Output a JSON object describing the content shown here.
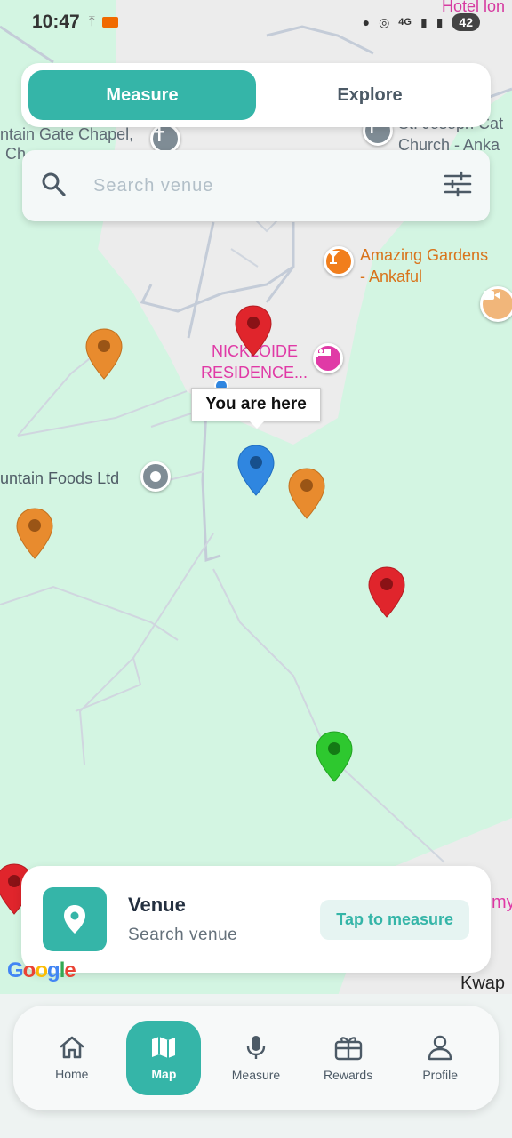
{
  "status_bar": {
    "time": "10:47",
    "network": "4G",
    "battery": "42"
  },
  "toggle": {
    "measure_label": "Measure",
    "explore_label": "Explore",
    "active": "Measure"
  },
  "search": {
    "placeholder": "Search venue"
  },
  "map": {
    "labels": {
      "hotel": "Hotel lon",
      "chapel_line1": "ntain Gate Chapel,",
      "chapel_line2": "Ch...",
      "church_line1": "St. Joseph Cat",
      "church_line2": "Church - Anka",
      "gardens_line1": "Amazing Gardens",
      "gardens_line2": "- Ankaful",
      "residence_line1": "NICKLOIDE",
      "residence_line2": "RESIDENCE...",
      "foods": "untain Foods Ltd",
      "kwap": "Kwap",
      "my": "my"
    },
    "you_are_here": "You are here",
    "marker_colors": {
      "red": "#e0252c",
      "orange": "#e88b2e",
      "green": "#2ec82f",
      "blue": "#2f86e0"
    },
    "poi_colors": {
      "church": "#7f8c95",
      "bar": "#f17e1c",
      "hotel": "#e03aa6"
    }
  },
  "venue_card": {
    "title": "Venue",
    "subtitle": "Search venue",
    "action_label": "Tap to measure"
  },
  "google_logo": "Google",
  "nav": {
    "items": [
      {
        "label": "Home"
      },
      {
        "label": "Map"
      },
      {
        "label": "Measure"
      },
      {
        "label": "Rewards"
      },
      {
        "label": "Profile"
      }
    ],
    "active": "Map"
  },
  "colors": {
    "accent": "#35b5a8",
    "map_background": "#d3f5e2"
  }
}
